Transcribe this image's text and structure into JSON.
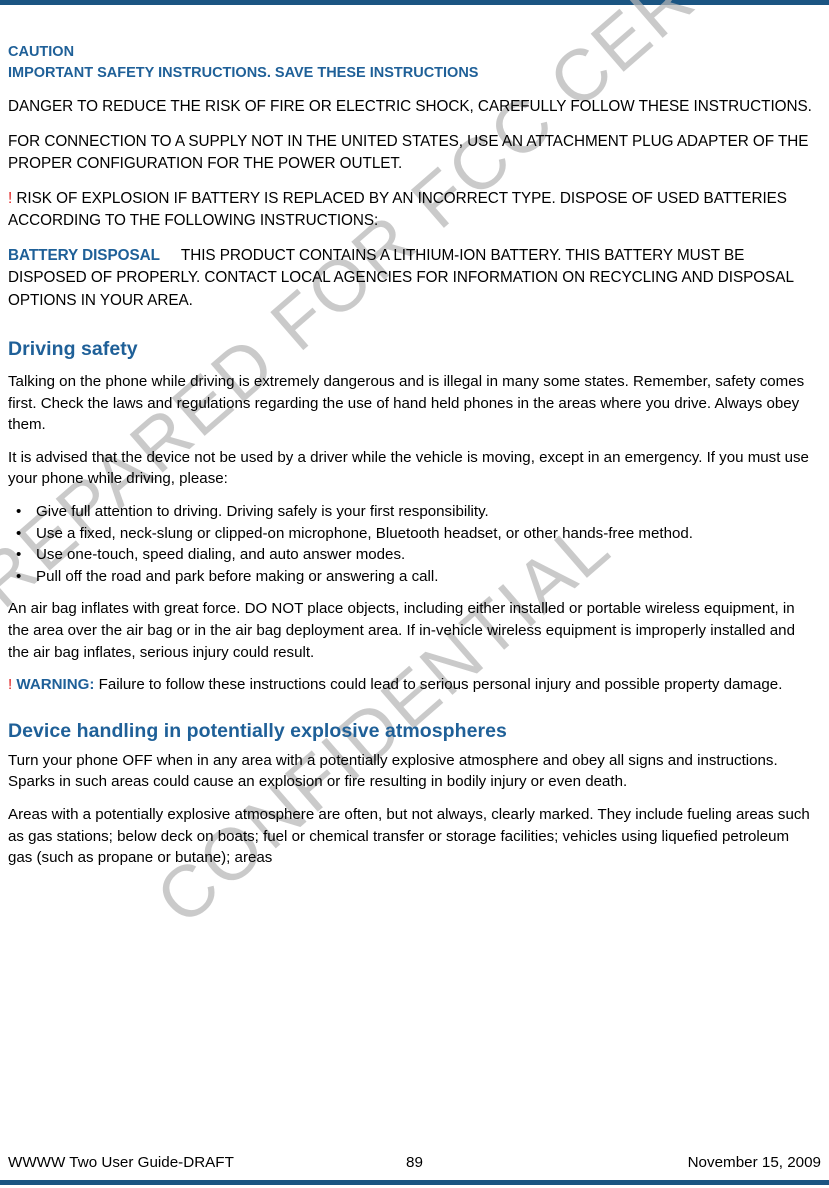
{
  "page": {
    "accent_blue": "#1f6098",
    "rule_blue": "#1b5582",
    "alert_red": "#e02020",
    "watermark_color": "#b7b7b7"
  },
  "watermark": {
    "line1": "PREPARED FOR FCC CERTIFICATION",
    "line2": "CONFIDENTIAL"
  },
  "caution": {
    "heading": "CAUTION",
    "subheading": "IMPORTANT SAFETY INSTRUCTIONS. SAVE THESE INSTRUCTIONS",
    "para_danger": "DANGER TO REDUCE THE RISK OF FIRE OR ELECTRIC SHOCK, CAREFULLY FOLLOW THESE INSTRUCTIONS.",
    "para_supply": "FOR CONNECTION TO A SUPPLY NOT IN THE UNITED STATES, USE AN ATTACHMENT PLUG ADAPTER OF THE PROPER CONFIGURATION FOR THE POWER OUTLET.",
    "bang": "!",
    "para_explosion": "RISK OF EXPLOSION IF BATTERY IS REPLACED BY AN INCORRECT TYPE. DISPOSE OF USED BATTERIES ACCORDING TO THE FOLLOWING INSTRUCTIONS:",
    "battery_disposal_label": "BATTERY DISPOSAL",
    "battery_disposal_text": "THIS PRODUCT CONTAINS A LITHIUM-ION BATTERY. THIS BATTERY MUST BE DISPOSED OF PROPERLY. CONTACT LOCAL AGENCIES FOR INFORMATION ON RECYCLING AND DISPOSAL OPTIONS IN YOUR AREA."
  },
  "driving_safety": {
    "heading": "Driving safety",
    "para1": "Talking on the phone while driving is extremely dangerous and is illegal in many some states. Remember, safety comes first. Check the laws and regulations regarding the use of hand held phones in the areas where you drive. Always obey them.",
    "para2": "It is advised that the device not be used by a driver while the vehicle is moving, except in an emergency. If you must use your phone while driving, please:",
    "bullet_marker": "•",
    "bullets": [
      "Give full attention to driving. Driving safely is your first responsibility.",
      "Use a fixed, neck-slung or clipped-on microphone, Bluetooth headset, or other hands-free method.",
      "Use one-touch, speed dialing, and auto answer modes.",
      "Pull off the road and park before making or answering a call."
    ],
    "para3": "An air bag inflates with great force. DO NOT place objects, including either installed or portable wireless equipment, in the area over the air bag or in the air bag deployment area. If in-vehicle wireless equipment is improperly installed and the air bag inflates, serious injury could result.",
    "warning_bang": "!",
    "warning_label": "WARNING:",
    "warning_text": "Failure to follow these instructions could lead to serious personal injury and possible property damage."
  },
  "explosive": {
    "heading": "Device handling in potentially explosive atmospheres",
    "para1": "Turn your phone OFF when in any area with a potentially explosive atmosphere and obey all signs and instructions. Sparks in such areas could cause an explosion or fire resulting in bodily injury or even death.",
    "para2": "Areas with a potentially explosive atmosphere are often, but not always, clearly marked. They include fueling areas such as gas stations; below deck on boats; fuel or chemical transfer or storage facilities; vehicles using liquefied petroleum gas (such as propane or butane); areas"
  },
  "footer": {
    "left": "WWWW Two User Guide-DRAFT",
    "page_number": "89",
    "right": "November 15, 2009"
  }
}
